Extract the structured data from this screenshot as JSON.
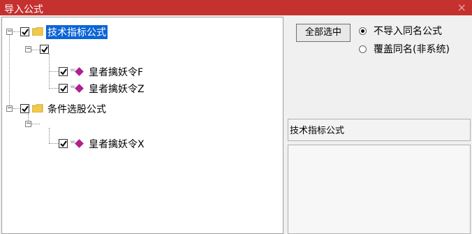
{
  "window": {
    "title": "导入公式",
    "close_glyph": "×"
  },
  "tree": {
    "nodes": [
      {
        "label": "技术指标公式",
        "type": "folder",
        "checked": true,
        "selected": true
      },
      {
        "label": "",
        "type": "group",
        "checked": true
      },
      {
        "label": "皇者擒妖令F",
        "type": "formula",
        "checked": true
      },
      {
        "label": "皇者擒妖令Z",
        "type": "formula",
        "checked": true
      },
      {
        "label": "条件选股公式",
        "type": "folder",
        "checked": true
      },
      {
        "label": "皇者擒妖令X",
        "type": "formula",
        "checked": true
      }
    ]
  },
  "options": {
    "select_all_label": "全部选中",
    "radio_no_import": "不导入同名公式",
    "radio_overwrite": "覆盖同名(非系统)",
    "selected_radio": "no_import"
  },
  "description": "技术指标公式",
  "colors": {
    "titlebar": "#c4312f",
    "selection": "#0a64d6",
    "formula_icon": "#b0208f",
    "folder": "#f2c94c"
  }
}
